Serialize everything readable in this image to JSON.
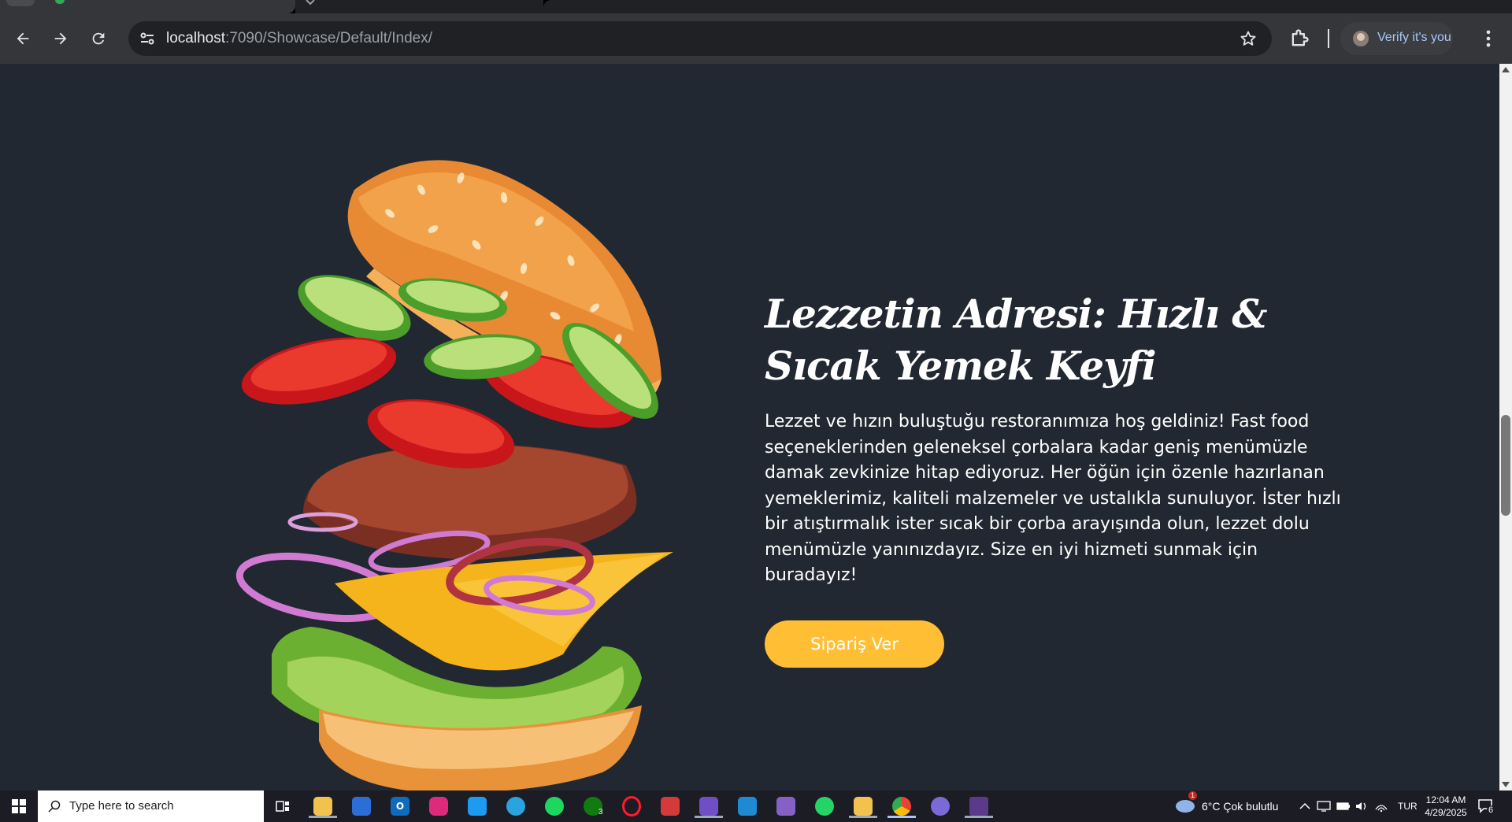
{
  "browser": {
    "url_host": "localhost",
    "url_path": ":7090/Showcase/Default/Index/",
    "profile_label": "Verify it's you"
  },
  "hero": {
    "title": "Lezzetin Adresi: Hızlı & Sıcak Yemek Keyfi",
    "description": "Lezzet ve hızın buluştuğu restoranımıza hoş geldiniz! Fast food seçeneklerinden geleneksel çorbalara kadar geniş menümüzle damak zevkinize hitap ediyoruz. Her öğün için özenle hazırlanan yemeklerimiz, kaliteli malzemeler ve ustalıkla sunuluyor. İster hızlı bir atıştırmalık ister sıcak bir çorba arayışında olun, lezzet dolu menümüzle yanınızdayız. Size en iyi hizmeti sunmak için buradayız!",
    "order_button": "Sipariş Ver"
  },
  "colors": {
    "page_bg": "#222831",
    "accent": "#ffbe33"
  },
  "taskbar": {
    "search_placeholder": "Type here to search",
    "apps": [
      "task-view",
      "file-explorer",
      "microsoft-store",
      "outlook",
      "instagram",
      "twitter",
      "telegram",
      "spotify",
      "xbox",
      "opera",
      "app-red",
      "visual-studio",
      "vs-code",
      "visual-studio-2",
      "whatsapp",
      "app-yellow",
      "chrome",
      "app-purple",
      "terminal"
    ],
    "xbox_badge": "3",
    "weather_badge": "1",
    "weather": "6°C  Çok bulutlu",
    "language": "TUR",
    "time": "12:04 AM",
    "date": "4/29/2025",
    "notification_count": "6"
  }
}
